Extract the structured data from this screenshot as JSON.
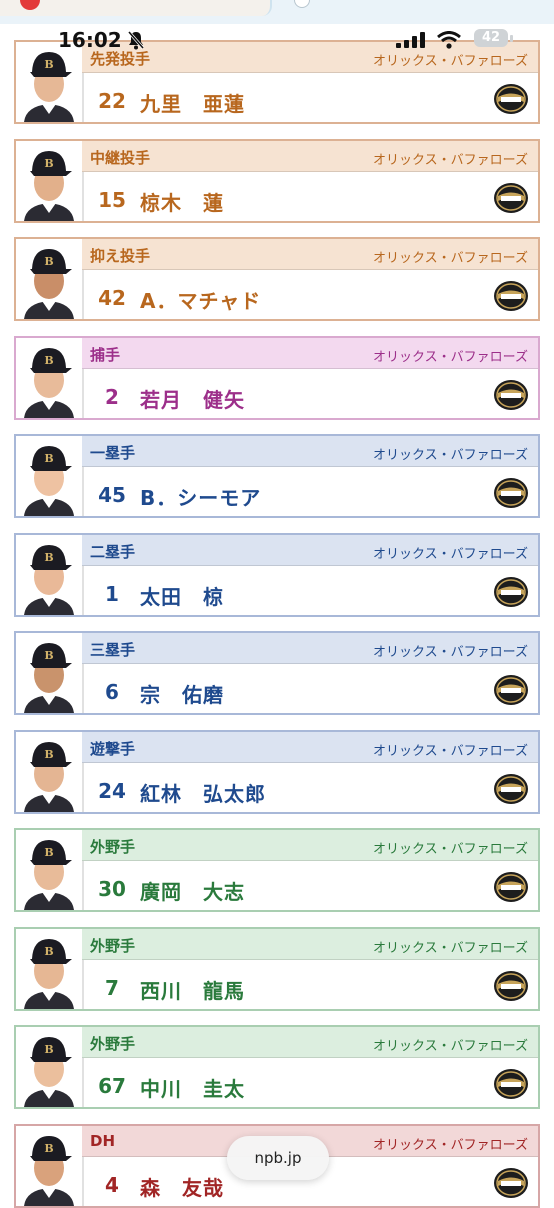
{
  "status_bar": {
    "time": "16:02",
    "battery": "42"
  },
  "browser": {
    "url": "npb.jp"
  },
  "colors": {
    "pitcher": "#b8671e",
    "catcher": "#9c2f8a",
    "infielder": "#1f4a8e",
    "outfielder": "#2a7a3c",
    "dh": "#a12525"
  },
  "players": [
    {
      "position": "先発投手",
      "team": "オリックス・バファローズ",
      "number": "22",
      "name": "九里　亜蓮",
      "theme": "p"
    },
    {
      "position": "中継投手",
      "team": "オリックス・バファローズ",
      "number": "15",
      "name": "椋木　蓮",
      "theme": "p"
    },
    {
      "position": "抑え投手",
      "team": "オリックス・バファローズ",
      "number": "42",
      "name": "A．マチャド",
      "theme": "p"
    },
    {
      "position": "捕手",
      "team": "オリックス・バファローズ",
      "number": "2",
      "name": "若月　健矢",
      "theme": "c"
    },
    {
      "position": "一塁手",
      "team": "オリックス・バファローズ",
      "number": "45",
      "name": "B．シーモア",
      "theme": "i"
    },
    {
      "position": "二塁手",
      "team": "オリックス・バファローズ",
      "number": "1",
      "name": "太田　椋",
      "theme": "i"
    },
    {
      "position": "三塁手",
      "team": "オリックス・バファローズ",
      "number": "6",
      "name": "宗　佑磨",
      "theme": "i"
    },
    {
      "position": "遊撃手",
      "team": "オリックス・バファローズ",
      "number": "24",
      "name": "紅林　弘太郎",
      "theme": "i"
    },
    {
      "position": "外野手",
      "team": "オリックス・バファローズ",
      "number": "30",
      "name": "廣岡　大志",
      "theme": "o"
    },
    {
      "position": "外野手",
      "team": "オリックス・バファローズ",
      "number": "7",
      "name": "西川　龍馬",
      "theme": "o"
    },
    {
      "position": "外野手",
      "team": "オリックス・バファローズ",
      "number": "67",
      "name": "中川　圭太",
      "theme": "o"
    },
    {
      "position": "DH",
      "team": "オリックス・バファローズ",
      "number": "4",
      "name": "森　友哉",
      "theme": "d"
    }
  ]
}
